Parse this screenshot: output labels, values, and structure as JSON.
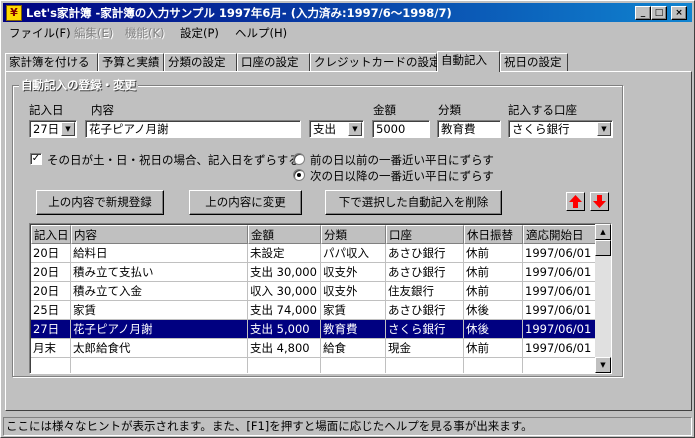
{
  "window": {
    "title": "Let's家計簿 -家計簿の入力サンプル 1997年6月- (入力済み:1997/6～1998/7)"
  },
  "menu": [
    {
      "label": "ファイル(F)",
      "enabled": true
    },
    {
      "label": "編集(E)",
      "enabled": false
    },
    {
      "label": "機能(K)",
      "enabled": false
    },
    {
      "label": "設定(P)",
      "enabled": true
    },
    {
      "label": "ヘルプ(H)",
      "enabled": true
    }
  ],
  "tabs": [
    "家計簿を付ける",
    "予算と実績",
    "分類の設定",
    "口座の設定",
    "クレジットカードの設定",
    "自動記入",
    "祝日の設定"
  ],
  "active_tab": "自動記入",
  "form": {
    "group_title": "自動記入の登録・変更",
    "day_label": "記入日",
    "day_value": "27日",
    "content_label": "内容",
    "content_value": "花子ピアノ月謝",
    "direction_value": "支出",
    "amount_label": "金額",
    "amount_value": "5000",
    "category_label": "分類",
    "category_value": "教育費",
    "account_label": "記入する口座",
    "account_value": "さくら銀行",
    "weekend_check_label": "その日が土・日・祝日の場合、記入日をずらする",
    "weekend_checked": true,
    "radio_before": "前の日以前の一番近い平日にずらす",
    "radio_after": "次の日以降の一番近い平日にずらす",
    "radio_selected": "after"
  },
  "buttons": {
    "register_new": "上の内容で新規登録",
    "change": "上の内容に変更",
    "delete": "下で選択した自動記入を削除"
  },
  "table": {
    "columns": [
      "記入日",
      "内容",
      "金額",
      "分類",
      "口座",
      "休日振替",
      "適応開始日"
    ],
    "rows": [
      [
        "20日",
        "給料日",
        "未設定",
        "パパ収入",
        "あさひ銀行",
        "休前",
        "1997/06/01"
      ],
      [
        "20日",
        "積み立て支払い",
        "支出 30,000",
        "収支外",
        "あさひ銀行",
        "休前",
        "1997/06/01"
      ],
      [
        "20日",
        "積み立て入金",
        "収入 30,000",
        "収支外",
        "住友銀行",
        "休前",
        "1997/06/01"
      ],
      [
        "25日",
        "家賃",
        "支出 74,000",
        "家賃",
        "あさひ銀行",
        "休後",
        "1997/06/01"
      ],
      [
        "27日",
        "花子ピアノ月謝",
        "支出 5,000",
        "教育費",
        "さくら銀行",
        "休後",
        "1997/06/01"
      ],
      [
        "月末",
        "太郎給食代",
        "支出 4,800",
        "給食",
        "現金",
        "休前",
        "1997/06/01"
      ]
    ],
    "selected_row": 4
  },
  "status": "ここには様々なヒントが表示されます。また、[F1]を押すと場面に応じたヘルプを見る事が出来ます。",
  "colors": {
    "title_bar": "#000080",
    "selection": "#000080",
    "arrow_red": "#ff0000"
  }
}
